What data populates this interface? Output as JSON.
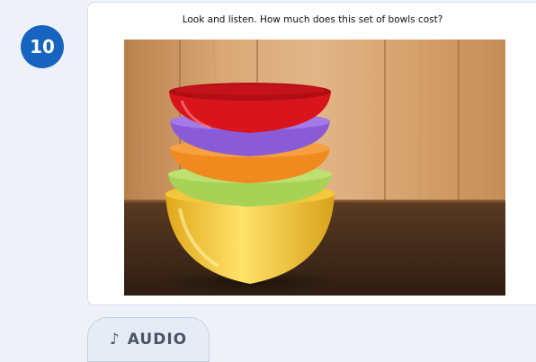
{
  "question": {
    "number": "10",
    "prompt": "Look and listen. How much does this set of bowls cost?"
  },
  "image": {
    "subject": "stack-of-colored-bowls",
    "bowl_colors": [
      "#d8141c",
      "#8a5bd6",
      "#f08a1e",
      "#a7d255",
      "#f1c62c"
    ],
    "colors": {
      "accent": "#1664c0"
    }
  },
  "audio": {
    "icon": "music-note-icon",
    "icon_glyph": "♪",
    "label": "AUDIO"
  }
}
